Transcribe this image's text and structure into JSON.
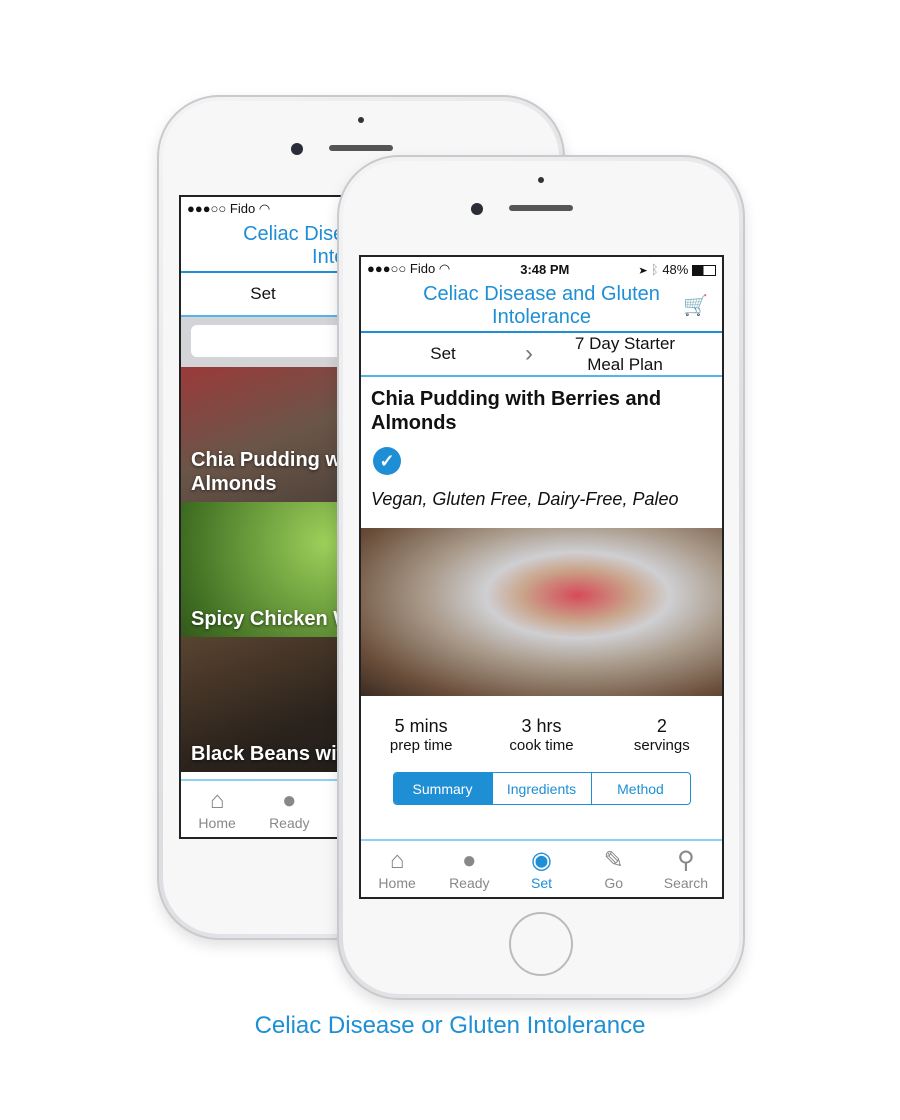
{
  "status": {
    "carrier": "Fido",
    "time": "3:48 PM",
    "battery": "48%"
  },
  "app_title": "Celiac Disease and Gluten Intolerance",
  "back_phone": {
    "breadcrumb": "Set",
    "recipes": [
      {
        "title": "Chia Pudding with Berries and Almonds"
      },
      {
        "title": "Spicy Chicken Wraps"
      },
      {
        "title": "Black Beans with"
      }
    ]
  },
  "front_phone": {
    "breadcrumb": {
      "parent": "Set",
      "current": "7 Day Starter Meal Plan"
    },
    "recipe": {
      "title": "Chia Pudding with Berries and Almonds",
      "tags": "Vegan, Gluten Free, Dairy-Free, Paleo",
      "stats": [
        {
          "value": "5 mins",
          "label": "prep time"
        },
        {
          "value": "3 hrs",
          "label": "cook time"
        },
        {
          "value": "2",
          "label": "servings"
        }
      ],
      "segments": [
        "Summary",
        "Ingredients",
        "Method"
      ],
      "selected_segment": "Summary"
    }
  },
  "tabs": [
    {
      "label": "Home",
      "icon": "home-icon"
    },
    {
      "label": "Ready",
      "icon": "apple-icon"
    },
    {
      "label": "Set",
      "icon": "plate-icon"
    },
    {
      "label": "Go",
      "icon": "notebook-icon"
    },
    {
      "label": "Search",
      "icon": "search-icon"
    }
  ],
  "active_tab": "Set",
  "caption": "Celiac Disease or Gluten Intolerance",
  "colors": {
    "accent": "#1e8fd5",
    "cart": "#7cc242"
  }
}
